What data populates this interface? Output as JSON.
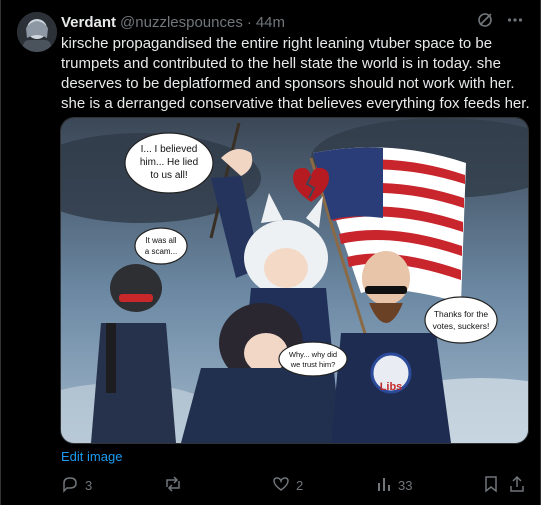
{
  "post": {
    "display_name": "Verdant",
    "handle": "@nuzzlespounces",
    "separator": "·",
    "time": "44m",
    "text": "kirsche propagandised the entire right leaning vtuber space to be trumpets and contributed to the hell state the world is in today. she deserves to be deplatformed and sponsors should not work with her. she is a derranged conservative that believes everything fox feeds her.",
    "edit_link": "Edit image"
  },
  "image": {
    "bubbles": [
      {
        "lines": [
          "I... I believed",
          "him... He lied",
          "to us all!"
        ]
      },
      {
        "lines": [
          "It was all",
          "a scam..."
        ]
      },
      {
        "lines": [
          "Thanks for the",
          "votes, suckers!"
        ]
      },
      {
        "lines": [
          "Why... why did",
          "we trust him?"
        ]
      }
    ],
    "badge_text": "Libs"
  },
  "actions": {
    "replies": "3",
    "reposts": "",
    "likes": "2",
    "views": "33"
  },
  "colors": {
    "accent": "#1d9bf0",
    "muted": "#71767b",
    "text": "#e7e9ea",
    "border": "#2f3336"
  },
  "icons": [
    "grok-icon",
    "more-icon",
    "reply-icon",
    "repost-icon",
    "like-icon",
    "views-icon",
    "bookmark-icon",
    "share-icon"
  ]
}
